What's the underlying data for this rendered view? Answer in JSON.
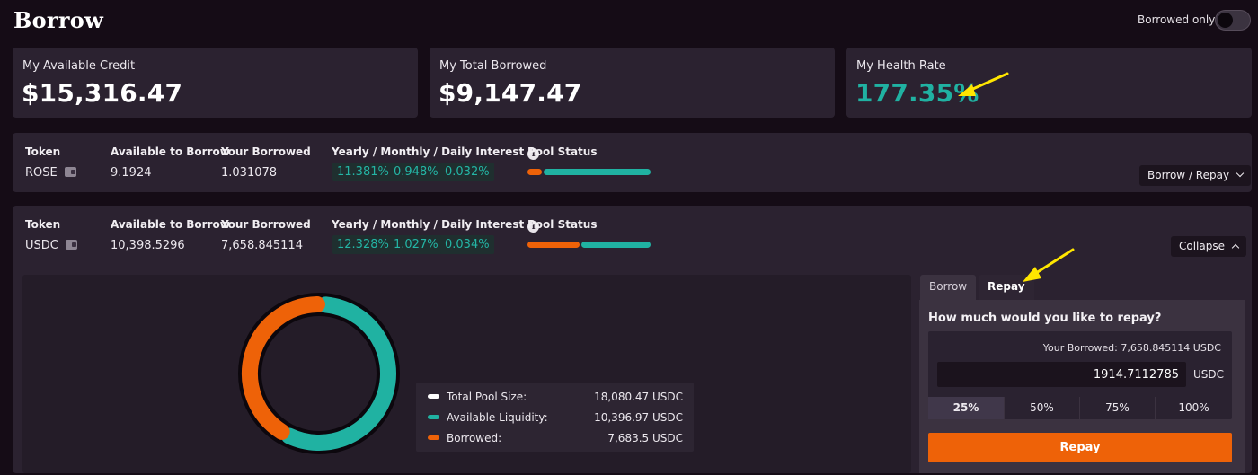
{
  "header": {
    "title": "Borrow",
    "borrowed_only_label": "Borrowed only:"
  },
  "summary": {
    "available_credit": {
      "title": "My Available Credit",
      "value": "$15,316.47"
    },
    "total_borrowed": {
      "title": "My Total Borrowed",
      "value": "$9,147.47"
    },
    "health_rate": {
      "title": "My Health Rate",
      "value": "177.35%"
    }
  },
  "columns": {
    "token": "Token",
    "available": "Available to Borrow",
    "borrowed": "Your Borrowed",
    "interest": "Yearly / Monthly / Daily Interest",
    "pool_status": "Pool Status"
  },
  "tokens": [
    {
      "name": "ROSE",
      "available": "9.1924",
      "borrowed": "1.031078",
      "yearly": "11.381%",
      "monthly": "0.948%",
      "daily": "0.032%",
      "borrowed_fraction": 0.12,
      "action_label": "Borrow / Repay"
    },
    {
      "name": "USDC",
      "available": "10,398.5296",
      "borrowed": "7,658.845114",
      "yearly": "12.328%",
      "monthly": "1.027%",
      "daily": "0.034%",
      "borrowed_fraction": 0.425,
      "action_label": "Collapse"
    }
  ],
  "pool_legend": [
    {
      "label": "Total Pool Size:",
      "value": "18,080.47 USDC",
      "color": "#ffffff"
    },
    {
      "label": "Available Liquidity:",
      "value": "10,396.97 USDC",
      "color": "#20b2a2"
    },
    {
      "label": "Borrowed:",
      "value": "7,683.5 USDC",
      "color": "#ee6208"
    }
  ],
  "pool_chart": {
    "available": 10396.97,
    "borrowed": 7683.5,
    "colors": {
      "available": "#20b2a2",
      "borrowed": "#ee6208"
    }
  },
  "repay": {
    "tabs": {
      "borrow": "Borrow",
      "repay": "Repay"
    },
    "question": "How much would you like to repay?",
    "your_borrowed": "Your Borrowed: 7,658.845114 USDC",
    "amount": "1914.7112785",
    "currency": "USDC",
    "percents": [
      "25%",
      "50%",
      "75%",
      "100%"
    ],
    "button_label": "Repay"
  }
}
